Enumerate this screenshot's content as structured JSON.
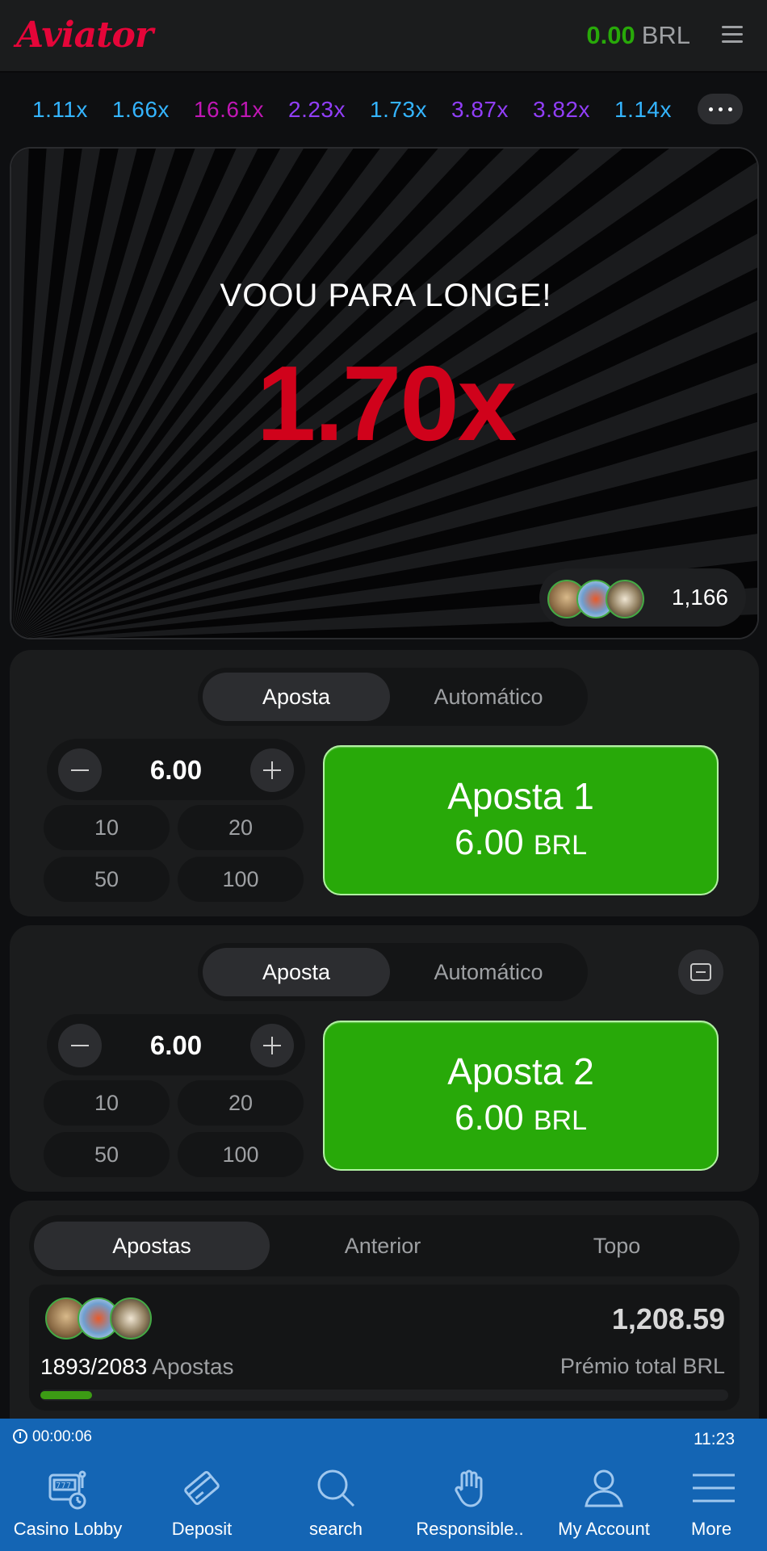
{
  "header": {
    "logo": "Aviator",
    "balance_amount": "0.00",
    "balance_currency": "BRL"
  },
  "history": [
    {
      "value": "1.11x",
      "color": "#34b4ff"
    },
    {
      "value": "1.66x",
      "color": "#34b4ff"
    },
    {
      "value": "16.61x",
      "color": "#c017b4"
    },
    {
      "value": "2.23x",
      "color": "#913ef8"
    },
    {
      "value": "1.73x",
      "color": "#34b4ff"
    },
    {
      "value": "3.87x",
      "color": "#913ef8"
    },
    {
      "value": "3.82x",
      "color": "#913ef8"
    },
    {
      "value": "1.14x",
      "color": "#34b4ff"
    }
  ],
  "game": {
    "status": "VOOU PARA LONGE!",
    "multiplier": "1.70x",
    "players_count": "1,166"
  },
  "bet_panels": [
    {
      "tab_active": "Aposta",
      "tab_inactive": "Automático",
      "stake": "6.00",
      "quick": [
        "10",
        "20",
        "50",
        "100"
      ],
      "button_label": "Aposta 1",
      "button_amount": "6.00",
      "button_currency": "BRL"
    },
    {
      "tab_active": "Aposta",
      "tab_inactive": "Automático",
      "stake": "6.00",
      "quick": [
        "10",
        "20",
        "50",
        "100"
      ],
      "button_label": "Aposta 2",
      "button_amount": "6.00",
      "button_currency": "BRL"
    }
  ],
  "bets_list": {
    "tabs": [
      "Apostas",
      "Anterior",
      "Topo"
    ],
    "count": "1893/2083",
    "count_label": "Apostas",
    "total": "1,208.59",
    "total_label": "Prémio total BRL",
    "progress_fraction": 0.075
  },
  "bottom_bar": {
    "timer": "00:00:06",
    "clock": "11:23",
    "nav": [
      {
        "label": "Casino Lobby",
        "icon": "slot-machine-icon"
      },
      {
        "label": "Deposit",
        "icon": "card-icon"
      },
      {
        "label": "search",
        "icon": "search-icon"
      },
      {
        "label": "Responsible..",
        "icon": "hand-icon"
      },
      {
        "label": "My Account",
        "icon": "user-icon"
      },
      {
        "label": "More",
        "icon": "menu-icon"
      }
    ]
  },
  "colors": {
    "accent_red": "#e50539",
    "win_green": "#28a909",
    "bottom_bar_blue": "#1465b4"
  }
}
